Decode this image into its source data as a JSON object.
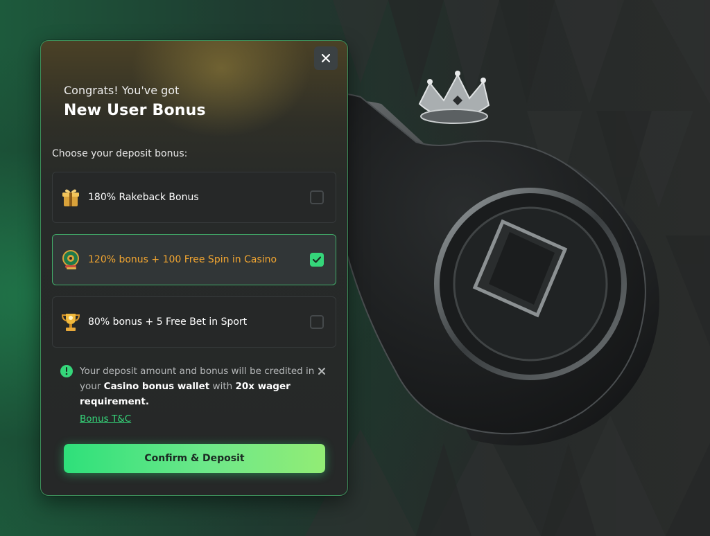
{
  "modal": {
    "subtitle": "Congrats! You've got",
    "title": "New User Bonus",
    "prompt": "Choose your deposit bonus:",
    "options": [
      {
        "label": "180% Rakeback Bonus",
        "icon": "gift-box-icon",
        "checked": false
      },
      {
        "label": "120% bonus + 100 Free Spin in Casino",
        "icon": "roulette-chips-icon",
        "checked": true
      },
      {
        "label": "80% bonus + 5 Free Bet in Sport",
        "icon": "trophy-icon",
        "checked": false
      }
    ],
    "notice": {
      "part1": "Your deposit amount and bonus will be credited in your ",
      "wallet": "Casino bonus wallet",
      "part2": " with ",
      "wager": "20x wager requirement.",
      "link": "Bonus T&C"
    },
    "confirm_label": "Confirm & Deposit"
  },
  "colors": {
    "accent": "#35d67a",
    "selected_text": "#f4a731",
    "border_selected": "#41ad69"
  }
}
